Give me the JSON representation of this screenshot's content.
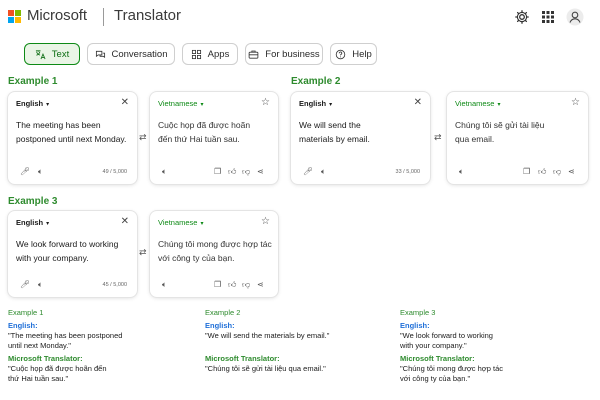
{
  "header": {
    "brand": "Microsoft",
    "product": "Translator",
    "icons": [
      "gear-icon",
      "apps-grid-icon",
      "avatar-icon"
    ]
  },
  "tabs": [
    {
      "label": "Text",
      "icon": "text-translate-icon",
      "active": true
    },
    {
      "label": "Conversation",
      "icon": "chat-icon",
      "active": false
    },
    {
      "label": "Apps",
      "icon": "grid-icon",
      "active": false
    },
    {
      "label": "For business",
      "icon": "briefcase-icon",
      "active": false
    },
    {
      "label": "Help",
      "icon": "help-icon",
      "active": false
    }
  ],
  "examples": [
    {
      "title": "Example 1",
      "source_lang": "English",
      "source_text_line1": "The meeting has been",
      "source_text_line2": "postponed until next Monday.",
      "char_count": "49 / 5,000",
      "target_lang": "Vietnamese",
      "target_text_line1": "Cuộc họp đã được hoãn",
      "target_text_line2": "đến thứ Hai tuần sau."
    },
    {
      "title": "Example 2",
      "source_lang": "English",
      "source_text_line1": "We will send the",
      "source_text_line2": "materials by email.",
      "char_count": "33 / 5,000",
      "target_lang": "Vietnamese",
      "target_text_line1": "Chúng tôi sẽ gửi tài liệu",
      "target_text_line2": "qua email."
    },
    {
      "title": "Example 3",
      "source_lang": "English",
      "source_text_line1": "We look forward to working",
      "source_text_line2": "with your company.",
      "char_count": "45 / 5,000",
      "target_lang": "Vietnamese",
      "target_text_line1": "Chúng tôi mong được hợp tác",
      "target_text_line2": "với công ty của bạn."
    }
  ],
  "summary": [
    {
      "title": "Example 1",
      "english_label": "English:",
      "english_line1": "\"The meeting has been postponed",
      "english_line2": "until next Monday.\"",
      "translator_label": "Microsoft Translator:",
      "translator_line1": "\"Cuộc họp đã được hoãn đến",
      "translator_line2": "thứ Hai tuần sau.\""
    },
    {
      "title": "Example 2",
      "english_label": "English:",
      "english_line1": "\"We will send the materials by email.\"",
      "english_line2": "",
      "translator_label": "Microsoft Translator:",
      "translator_line1": "\"Chúng tôi sẽ gửi tài liệu qua email.\"",
      "translator_line2": ""
    },
    {
      "title": "Example 3",
      "english_label": "English:",
      "english_line1": "\"We look forward to working",
      "english_line2": "with your company.\"",
      "translator_label": "Microsoft Translator:",
      "translator_line1": "\"Chúng tôi mong được hợp tác",
      "translator_line2": "với công ty của bạn.\""
    }
  ],
  "colors": {
    "accent_green": "#0e8a16",
    "title_green": "#2e8b2e",
    "label_blue": "#1f6fd8",
    "logo_red": "#f25022",
    "logo_green": "#7fba00",
    "logo_blue": "#00a4ef",
    "logo_yellow": "#ffb900"
  }
}
